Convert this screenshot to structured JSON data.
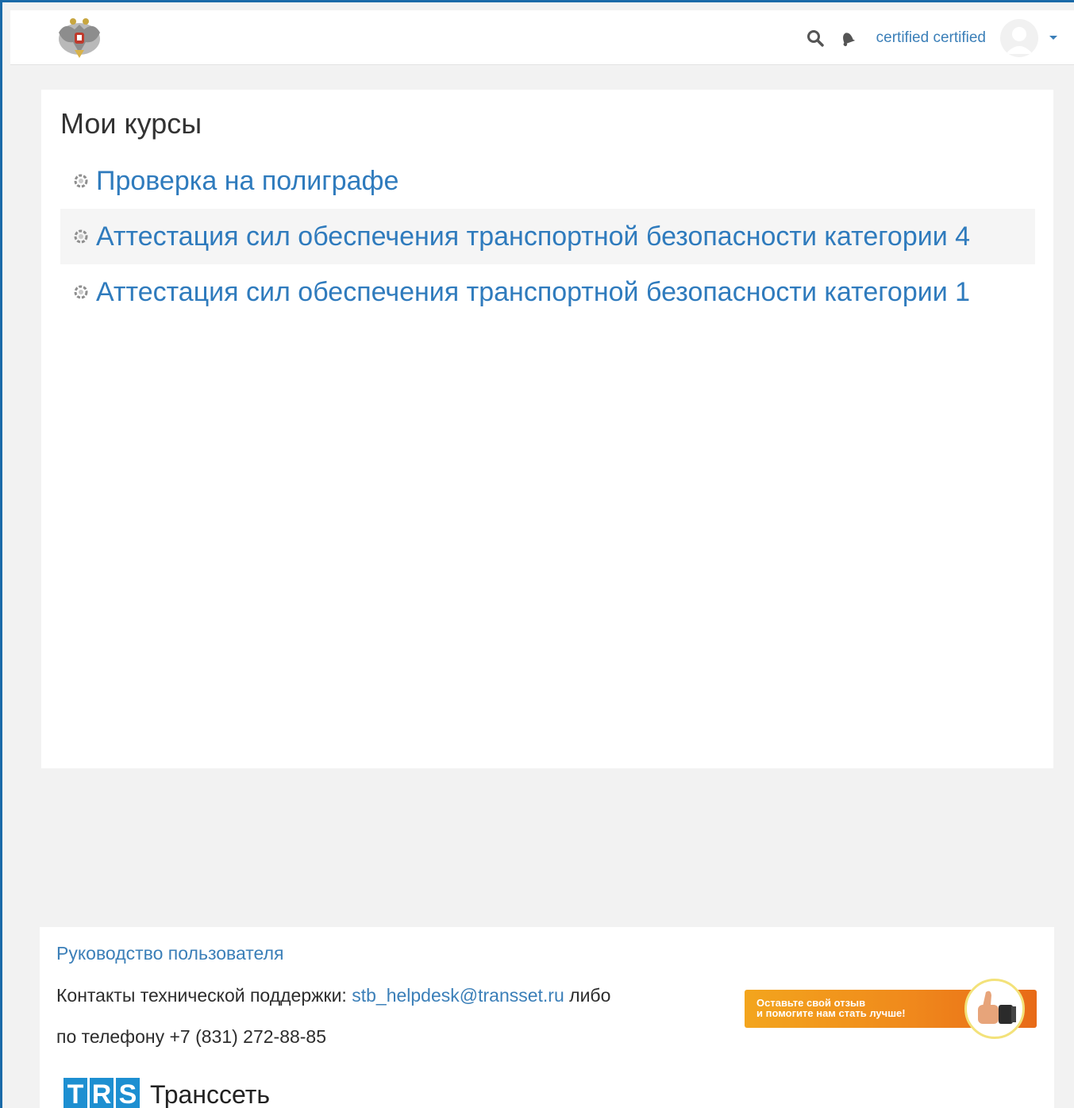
{
  "header": {
    "user_name": "certified certified",
    "icons": [
      "eagle-emblem-icon",
      "search-icon",
      "bell-icon",
      "user-avatar-icon",
      "caret-down-icon"
    ]
  },
  "main": {
    "title": "Мои курсы",
    "courses": [
      {
        "label": "Проверка на полиграфе"
      },
      {
        "label": "Аттестация сил обеспечения транспортной безопасности категории 4"
      },
      {
        "label": "Аттестация сил обеспечения транспортной безопасности категории 1"
      }
    ]
  },
  "footer": {
    "guide_link": "Руководство пользователя",
    "support_prefix": "Контакты технической поддержки: ",
    "support_email": "stb_helpdesk@transset.ru",
    "support_suffix": " либо",
    "phone_line": "по телефону +7 (831) 272-88-85",
    "feedback_line1": "Оставьте свой отзыв",
    "feedback_line2": "и помогите нам стать лучше!",
    "brand_letters": [
      "T",
      "R",
      "S"
    ],
    "brand_name": "Транссеть"
  },
  "colors": {
    "link": "#2f7bbd",
    "frame": "#1a6aa8",
    "background": "#f2f2f2",
    "banner": "#f08a1c",
    "brand": "#1d8fd1"
  }
}
